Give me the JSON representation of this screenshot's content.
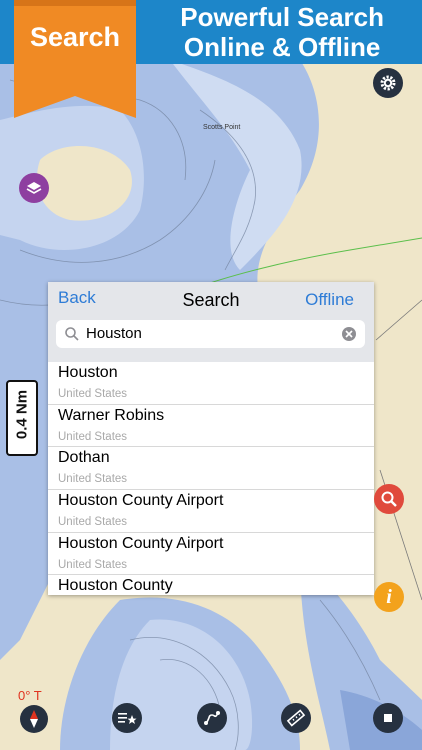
{
  "banner": {
    "ribbon_label": "Search",
    "headline_line1": "Powerful Search",
    "headline_line2": "Online & Offline"
  },
  "map": {
    "place_label": "Scotts Point",
    "scale_label": "0.4 Nm",
    "heading_readout": "0° T"
  },
  "search_panel": {
    "back_label": "Back",
    "title": "Search",
    "offline_label": "Offline",
    "query": "Houston",
    "results": [
      {
        "name": "Houston",
        "country": "United States"
      },
      {
        "name": "Warner Robins",
        "country": "United States"
      },
      {
        "name": "Dothan",
        "country": "United States"
      },
      {
        "name": "Houston County Airport",
        "country": "United States"
      },
      {
        "name": "Houston County Airport",
        "country": "United States"
      },
      {
        "name": "Houston County",
        "country": ""
      }
    ]
  },
  "icons": {
    "settings": "gear-icon",
    "layers": "layers-icon",
    "search": "search-icon",
    "info": "info-icon",
    "compass": "compass-icon",
    "favorites": "star-list-icon",
    "route": "route-icon",
    "ruler": "ruler-icon",
    "stop": "stop-icon"
  },
  "colors": {
    "banner": "#1d86c9",
    "ribbon": "#f08a24",
    "link": "#2e7cd6",
    "water": "#a9bfe6",
    "land": "#efe6c9"
  }
}
